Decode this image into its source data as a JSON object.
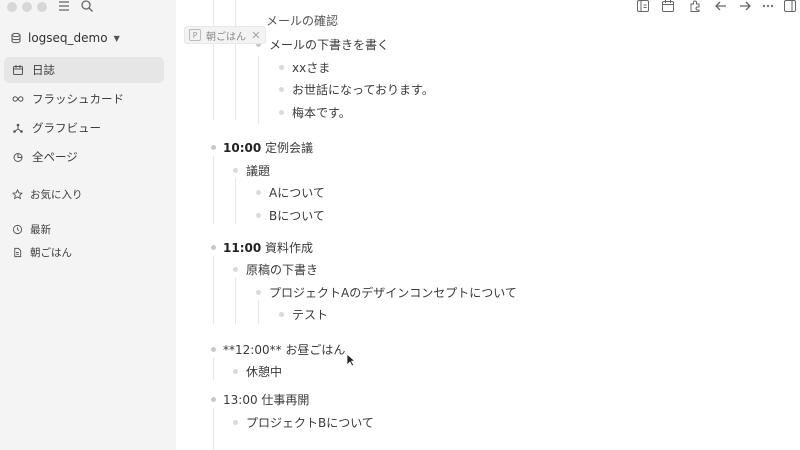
{
  "sidebar": {
    "graph_name": "logseq_demo",
    "nav": [
      {
        "label": "日誌",
        "icon": "calendar-icon",
        "active": true
      },
      {
        "label": "フラッシュカード",
        "icon": "infinity-icon"
      },
      {
        "label": "グラフビュー",
        "icon": "graph-icon"
      },
      {
        "label": "全ページ",
        "icon": "pages-icon"
      }
    ],
    "favorites_label": "お気に入り",
    "recent_label": "最新",
    "recent_items": [
      "朝ごはん"
    ]
  },
  "pinned_chip": {
    "badge": "P",
    "label": "朝ごはん"
  },
  "blocks": {
    "partial_top": "メールの確認",
    "mail_draft": "メールの下書きを書く",
    "xx": "xxさま",
    "osewa": "お世話になっております。",
    "umemoto": "梅本です。",
    "b1_time": "10:00",
    "b1_text": "定例会議",
    "agenda": "議題",
    "agenda_a": "Aについて",
    "agenda_b": "Bについて",
    "b2_time": "11:00",
    "b2_text": "資料作成",
    "draft": "原稿の下書き",
    "project_a": "プロジェクトAのデザインコンセプトについて",
    "test": "テスト",
    "b3": "**12:00** お昼ごはん",
    "rest": "休憩中",
    "b4": "13:00 仕事再開",
    "project_b": "プロジェクトBについて"
  }
}
